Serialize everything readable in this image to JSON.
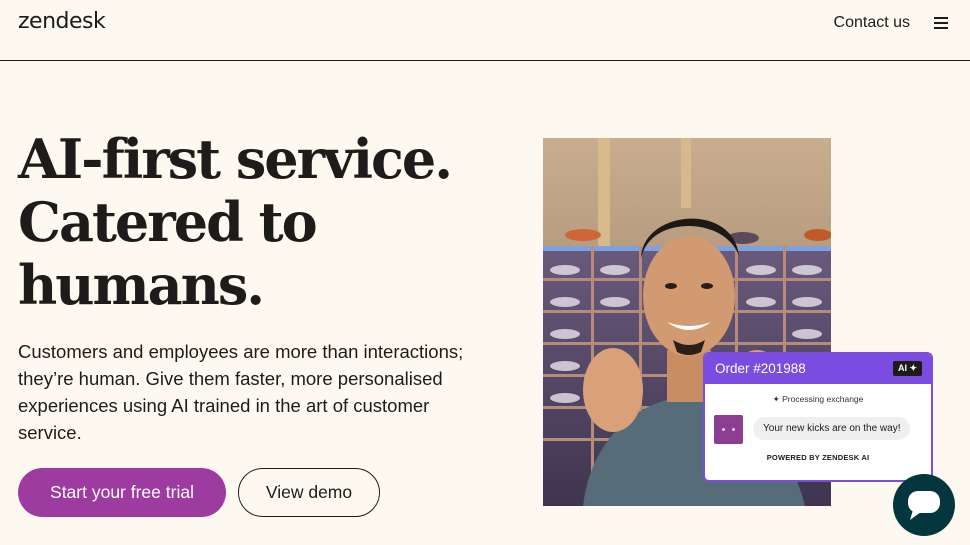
{
  "header": {
    "logo": "zendesk",
    "contact_label": "Contact us",
    "menu_icon": "hamburger-menu-icon"
  },
  "hero": {
    "title_lines": [
      "AI-first service.",
      "Catered to",
      "humans."
    ],
    "subtitle": "Customers and employees are more than interactions; they’re human. Give them faster, more personalised experiences using AI trained in the art of customer service.",
    "primary_cta": "Start your free trial",
    "secondary_cta": "View demo"
  },
  "order_card": {
    "title": "Order #201988",
    "badge": "AI",
    "status": "Processing exchange",
    "message": "Your new kicks are on the way!",
    "footer": "POWERED BY ZENDESK AI"
  },
  "colors": {
    "background": "#fdf9f1",
    "primary_button": "#9e3ba0",
    "card_accent": "#7b4ce0",
    "chat_button": "#04363d"
  }
}
